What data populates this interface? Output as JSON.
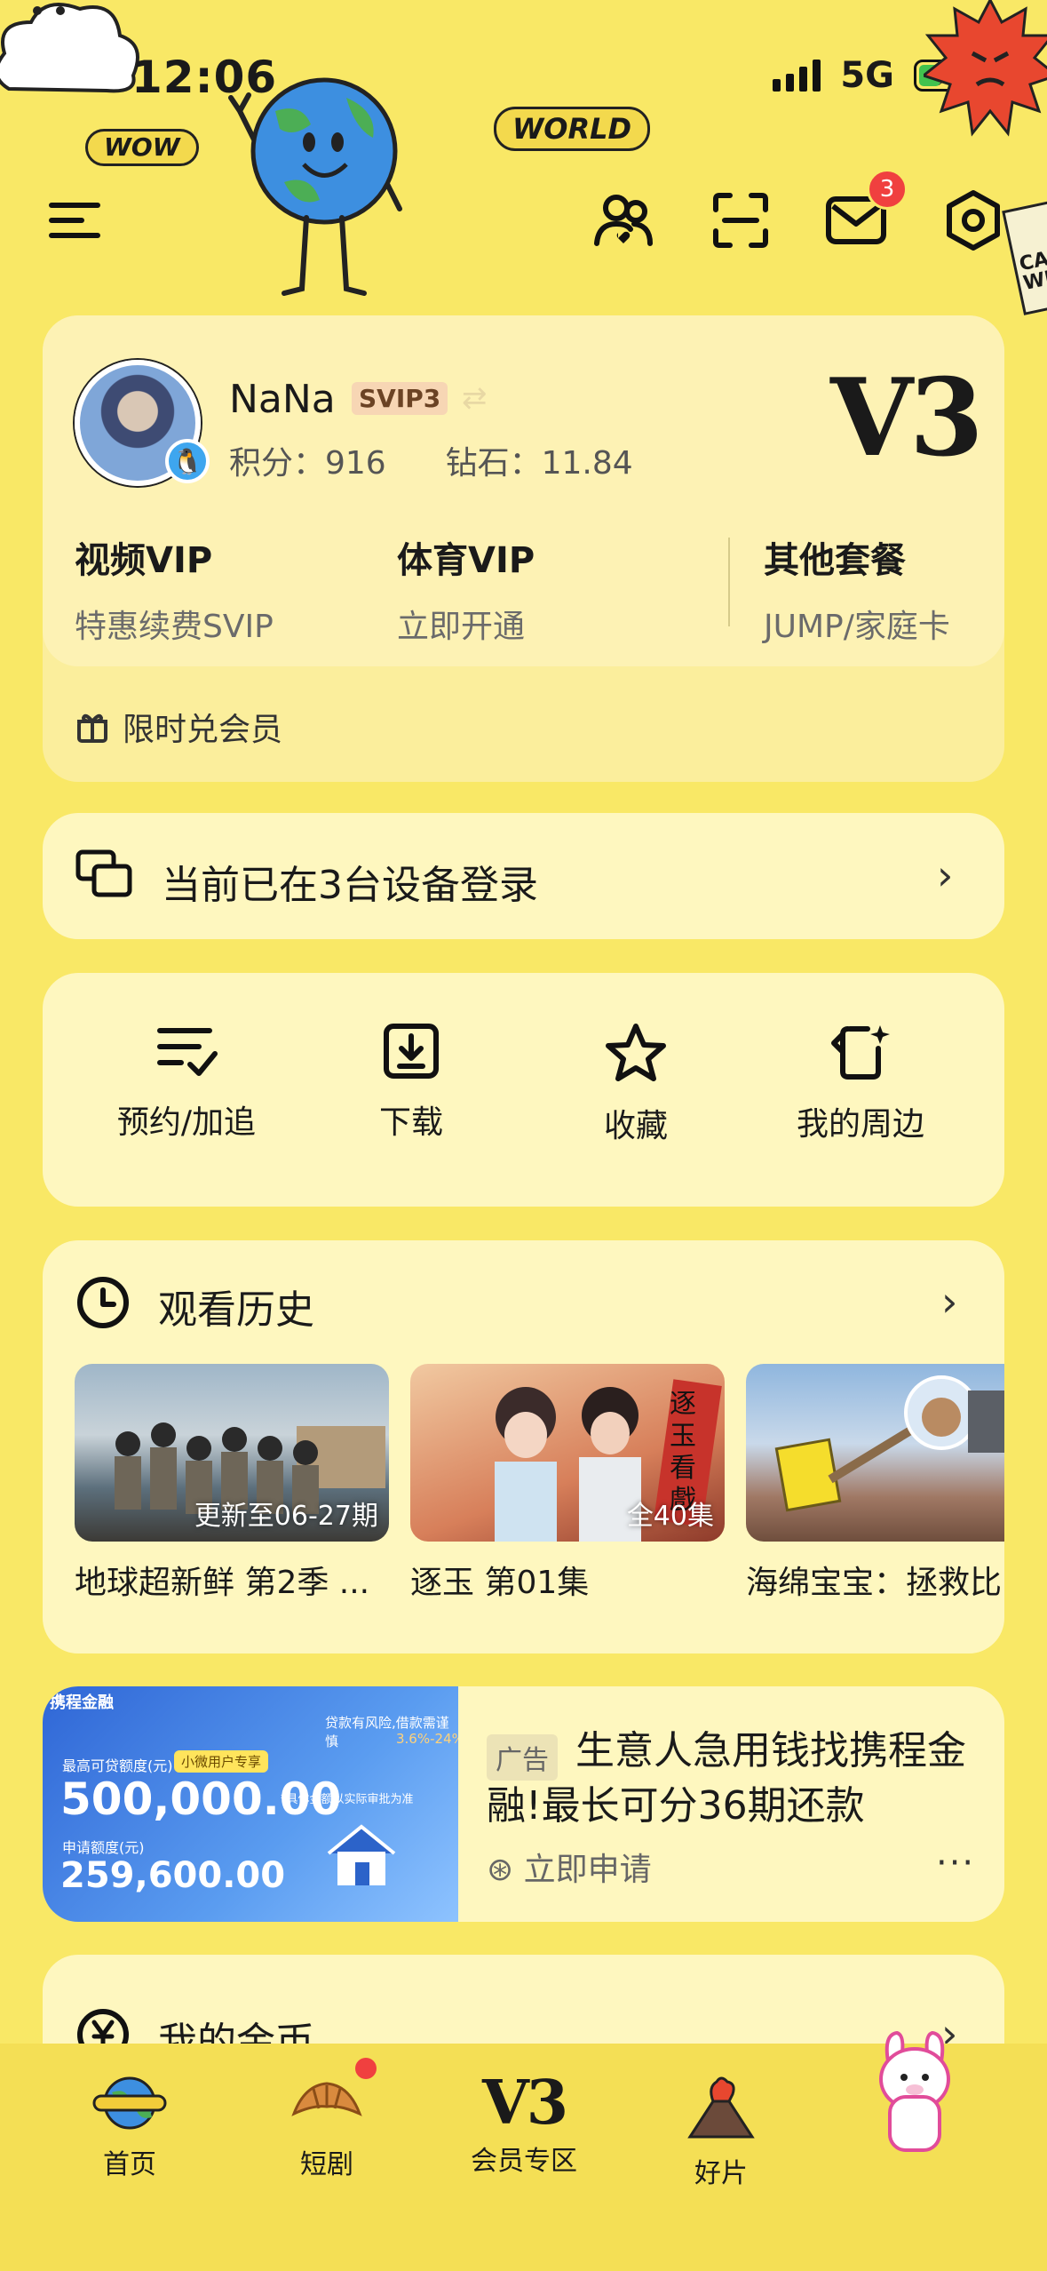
{
  "status": {
    "time": "12:06",
    "network": "5G"
  },
  "decor": {
    "wow": "WOW",
    "world": "WORLD",
    "side_sign": "CA WE"
  },
  "header": {
    "icons": [
      "menu-icon",
      "friends-icon",
      "scan-icon",
      "mail-icon",
      "settings-icon"
    ],
    "mail_badge": "3"
  },
  "profile": {
    "name": "NaNa",
    "svip": "SVIP3",
    "points": "积分：916",
    "diamonds": "钻石：11.84",
    "level": "V3"
  },
  "vip": [
    {
      "title": "视频VIP",
      "sub": "特惠续费SVIP"
    },
    {
      "title": "体育VIP",
      "sub": "立即开通"
    },
    {
      "title": "其他套餐",
      "sub": "JUMP/家庭卡"
    }
  ],
  "redeem": {
    "label": "限时兑会员"
  },
  "device": {
    "label": "当前已在3台设备登录"
  },
  "shortcuts": [
    {
      "label": "预约/加追",
      "icon": "reserve-list-icon"
    },
    {
      "label": "下载",
      "icon": "download-icon"
    },
    {
      "label": "收藏",
      "icon": "star-icon"
    },
    {
      "label": "我的周边",
      "icon": "merch-icon"
    }
  ],
  "history": {
    "title": "观看历史",
    "items": [
      {
        "caption": "地球超新鲜 第2季 ...",
        "tag": "更新至06-27期"
      },
      {
        "caption": "逐玉 第01集",
        "tag": "全40集",
        "poster_text": "逐玉看戲"
      },
      {
        "caption": "海绵宝宝：拯救比",
        "tag": ""
      }
    ]
  },
  "ad": {
    "tag": "广告",
    "title": "生意人急用钱找携程金融!最长可分36期还款",
    "apply": "立即申请",
    "more": "···",
    "image": {
      "brand": "携程金融",
      "label1": "最高可贷额度(元)",
      "chip": "小微用户专享",
      "amount": "500,000.00",
      "note": "*具体金额以实际审批为准",
      "label2": "申请额度(元)",
      "amount2": "259,600.00",
      "risk": "贷款有风险,借款需谨慎",
      "rate": "3.6%-24%"
    }
  },
  "coins": {
    "title": "我的金币"
  },
  "tabs": [
    {
      "label": "首页",
      "icon": "home-world-icon"
    },
    {
      "label": "短剧",
      "icon": "croissant-icon"
    },
    {
      "label": "会员专区",
      "icon": "v3-icon",
      "mark": "V3"
    },
    {
      "label": "好片",
      "icon": "volcano-icon"
    },
    {
      "label": "",
      "icon": "alpaca-icon"
    }
  ],
  "colors": {
    "background": "#F9E866",
    "card": "#FEF7BF",
    "badge": "#F0403F"
  }
}
